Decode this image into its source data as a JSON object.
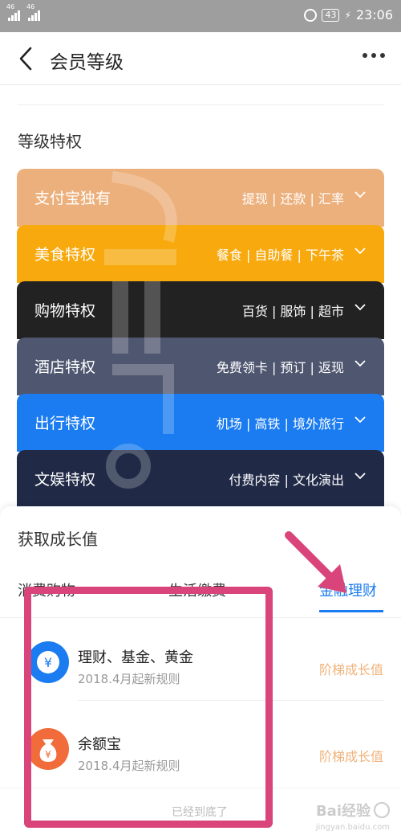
{
  "status_bar": {
    "signal1_label": "46",
    "signal2_label": "46",
    "battery": "43",
    "time": "23:06"
  },
  "nav": {
    "title": "会员等级"
  },
  "privileges": {
    "section_title": "等级特权",
    "cards": [
      {
        "name": "支付宝独有",
        "tags": "提现 | 还款 | 汇率",
        "color": "#ecb07c"
      },
      {
        "name": "美食特权",
        "tags": "餐食 | 自助餐 | 下午茶",
        "color": "#f7a90e"
      },
      {
        "name": "购物特权",
        "tags": "百货 | 服饰 | 超市",
        "color": "#222222"
      },
      {
        "name": "酒店特权",
        "tags": "免费领卡 | 预订 | 返现",
        "color": "#4f5670"
      },
      {
        "name": "出行特权",
        "tags": "机场 | 高铁 | 境外旅行",
        "color": "#1a7cf0"
      },
      {
        "name": "文娱特权",
        "tags": "付费内容 | 文化演出",
        "color": "#202a47"
      }
    ]
  },
  "growth": {
    "title": "获取成长值",
    "tabs": [
      {
        "label": "消费购物",
        "active": false
      },
      {
        "label": "生活缴费",
        "active": false
      },
      {
        "label": "金融理财",
        "active": true
      }
    ],
    "items": [
      {
        "title": "理财、基金、黄金",
        "subtitle": "2018.4月起新规则",
        "right": "阶梯成长值",
        "icon": "yuan-coin-icon"
      },
      {
        "title": "余额宝",
        "subtitle": "2018.4月起新规则",
        "right": "阶梯成长值",
        "icon": "money-bag-icon"
      }
    ],
    "end_text": "已经到底了"
  },
  "annotation": {
    "box_color": "#d9457b"
  },
  "watermark": {
    "brand": "Bai经验",
    "url": "jingyan.baidu.com"
  }
}
